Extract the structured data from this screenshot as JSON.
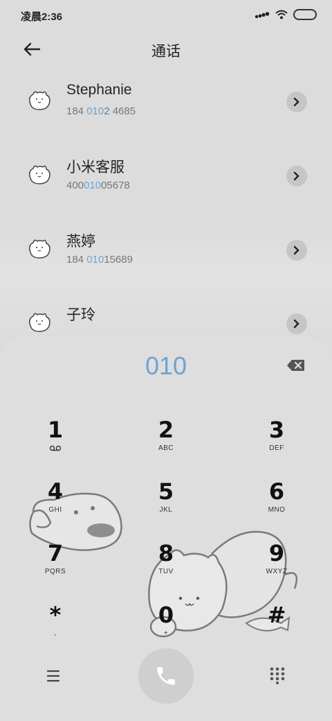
{
  "status_bar": {
    "time": "凌晨2:36"
  },
  "header": {
    "title": "通话"
  },
  "contacts": [
    {
      "name": "Stephanie",
      "number_pre": "184 ",
      "number_hl": "010",
      "number_post": "2 4685"
    },
    {
      "name": "小米客服",
      "number_pre": "400",
      "number_hl": "010",
      "number_post": "05678"
    },
    {
      "name": "燕婷",
      "number_pre": "184 ",
      "number_hl": "010",
      "number_post": "15689"
    },
    {
      "name": "子玲",
      "number_pre": "",
      "number_hl": "",
      "number_post": ""
    }
  ],
  "dialpad": {
    "display": "010",
    "keys": [
      {
        "digit": "1",
        "letters": ""
      },
      {
        "digit": "2",
        "letters": "ABC"
      },
      {
        "digit": "3",
        "letters": "DEF"
      },
      {
        "digit": "4",
        "letters": "GHI"
      },
      {
        "digit": "5",
        "letters": "JKL"
      },
      {
        "digit": "6",
        "letters": "MNO"
      },
      {
        "digit": "7",
        "letters": "PQRS"
      },
      {
        "digit": "8",
        "letters": "TUV"
      },
      {
        "digit": "9",
        "letters": "WXYZ"
      },
      {
        "digit": "*",
        "letters": ","
      },
      {
        "digit": "0",
        "letters": "+"
      },
      {
        "digit": "#",
        "letters": ""
      }
    ]
  },
  "icons": {
    "back": "back-arrow-icon",
    "detail": "chevron-right-icon",
    "backspace": "backspace-icon",
    "menu": "menu-icon",
    "call": "phone-icon",
    "dialpad": "dialpad-grid-icon",
    "voicemail": "voicemail-icon"
  },
  "colors": {
    "highlight": "#6ea3d2",
    "background": "#dcdcdc"
  }
}
